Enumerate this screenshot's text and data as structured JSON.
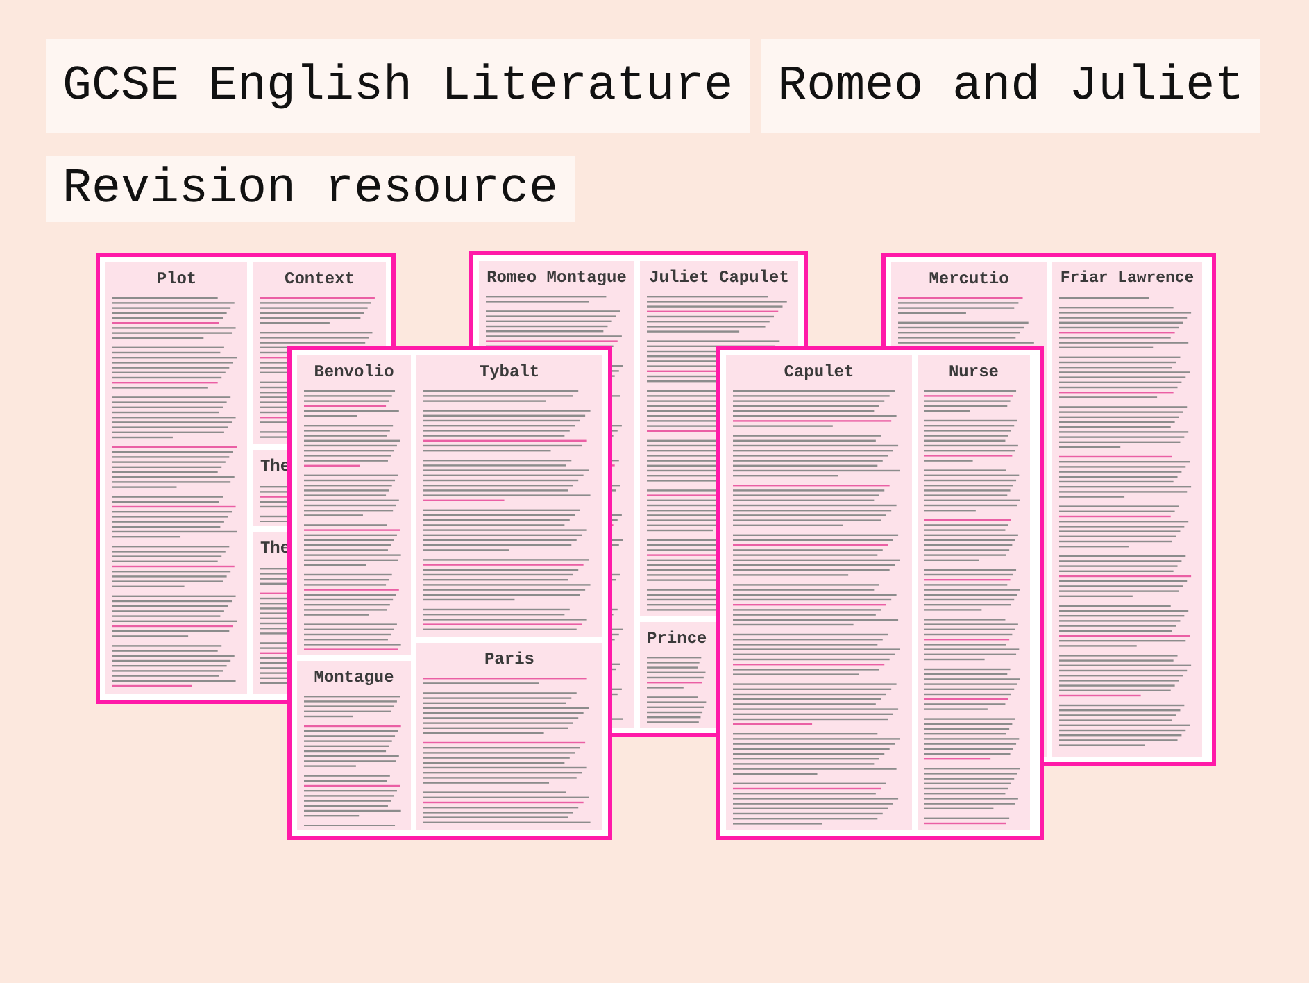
{
  "title_rows": [
    [
      "GCSE English Literature",
      "Romeo and Juliet"
    ],
    [
      "Revision resource"
    ]
  ],
  "sheets": [
    {
      "columns": [
        [
          {
            "heading": "Plot"
          }
        ],
        [
          {
            "heading": "Context"
          },
          {
            "heading": "The"
          },
          {
            "heading": "The"
          }
        ]
      ]
    },
    {
      "columns": [
        [
          {
            "heading": "Romeo Montague"
          }
        ],
        [
          {
            "heading": "Juliet Capulet"
          },
          {
            "heading": "Prince"
          }
        ]
      ]
    },
    {
      "columns": [
        [
          {
            "heading": "Mercutio"
          }
        ],
        [
          {
            "heading": "Friar Lawrence"
          }
        ]
      ]
    },
    {
      "columns": [
        [
          {
            "heading": "Benvolio"
          },
          {
            "heading": "Montague"
          }
        ],
        [
          {
            "heading": "Tybalt"
          },
          {
            "heading": "Paris"
          }
        ]
      ]
    },
    {
      "columns": [
        [
          {
            "heading": "Capulet"
          }
        ],
        [
          {
            "heading": "Nurse"
          }
        ]
      ]
    }
  ]
}
